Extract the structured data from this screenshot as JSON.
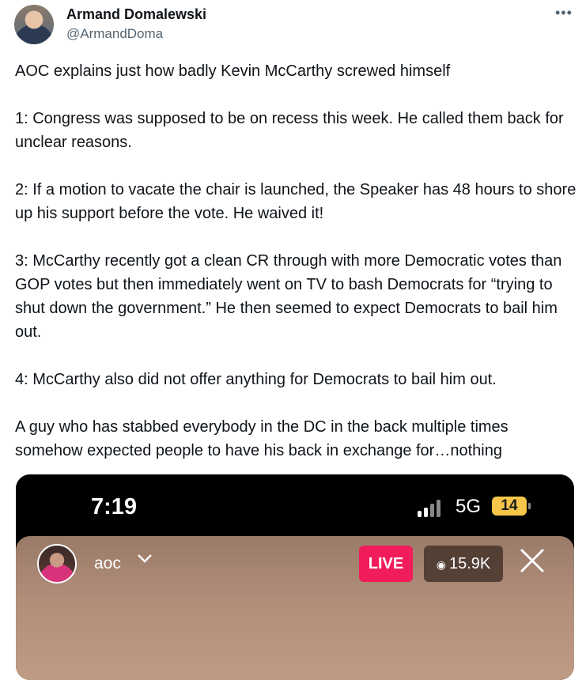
{
  "author": {
    "name": "Armand Domalewski",
    "handle": "@ArmandDoma"
  },
  "menu_icon": "more-icon",
  "tweet": {
    "text": "AOC explains just how badly Kevin McCarthy screwed himself\n\n1: Congress was supposed to be on recess this week. He called them back for unclear reasons.\n\n2: If a motion to vacate the chair is launched, the Speaker has 48 hours to shore up his support before the vote. He waived it!\n\n3: McCarthy recently got a clean CR through with more Democratic votes than GOP votes but then immediately went on TV to bash Democrats for “trying to shut down the government.” He then seemed to expect Democrats to bail him out.\n\n4:  McCarthy also did not offer anything for Democrats to bail him out.\n\nA guy who has stabbed everybody in the DC in the back multiple times somehow expected people to have his back in exchange for…nothing"
  },
  "media": {
    "status_bar": {
      "time": "7:19",
      "network": "5G",
      "battery": "14"
    },
    "live": {
      "username": "aoc",
      "live_label": "LIVE",
      "viewers": "15.9K"
    }
  },
  "colors": {
    "live_badge": "#f01d5a",
    "battery": "#f5c64a",
    "handle_text": "#536471"
  }
}
